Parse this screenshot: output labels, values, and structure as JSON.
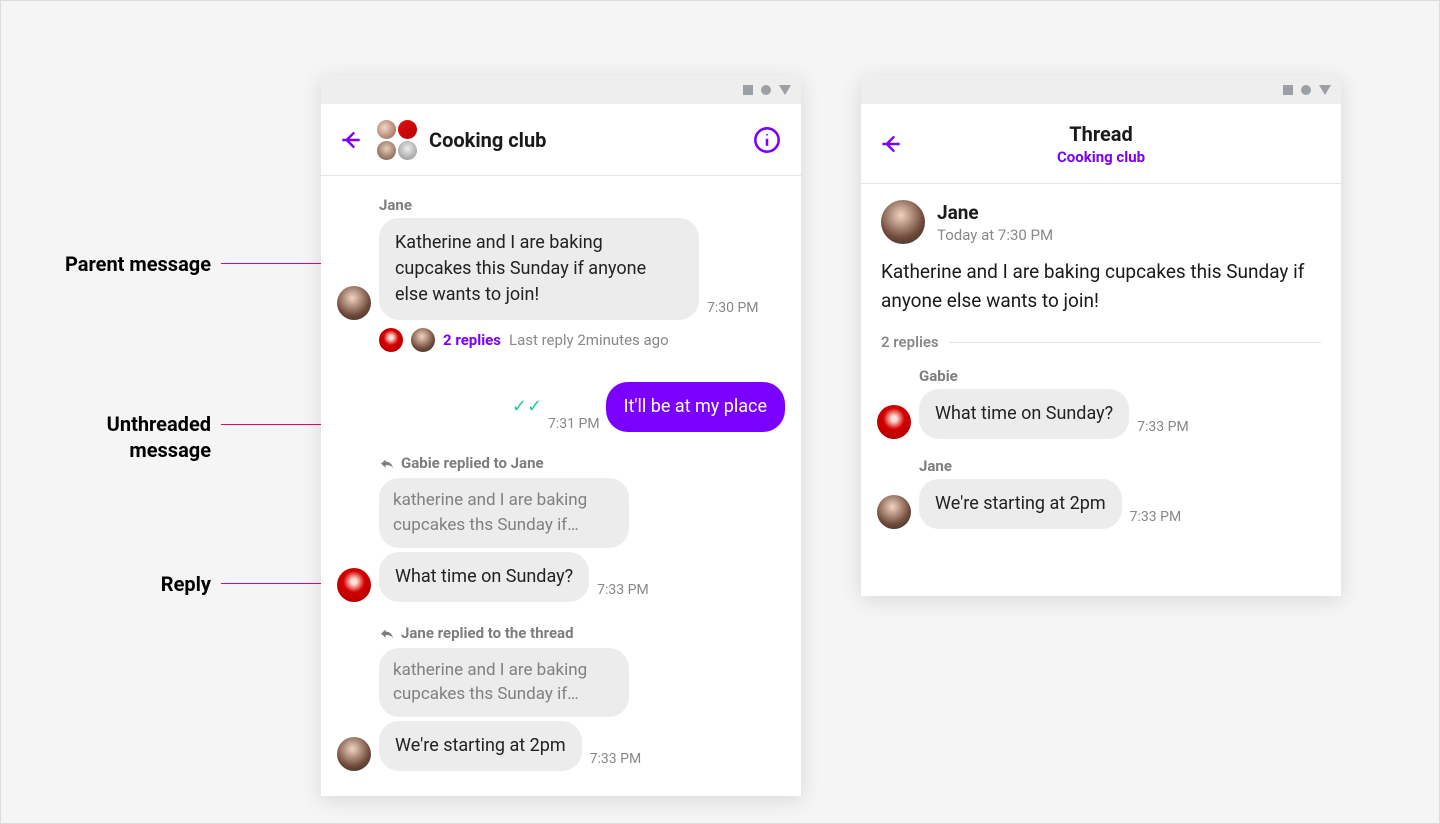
{
  "annotations": {
    "parent": "Parent message",
    "unthreaded_l1": "Unthreaded",
    "unthreaded_l2": "message",
    "reply": "Reply"
  },
  "left": {
    "chat_title": "Cooking club",
    "msg1_sender": "Jane",
    "msg1_text": "Katherine and I are baking cupcakes this Sunday if anyone else wants to join!",
    "msg1_ts": "7:30 PM",
    "thread_count": "2 replies",
    "thread_last": "Last reply 2minutes ago",
    "mine_ts": "7:31 PM",
    "mine_text": "It'll be at my place",
    "reply1_header": "Gabie replied to Jane",
    "quote_text": "katherine and I are baking cupcakes ths Sunday if…",
    "reply1_text": "What time on Sunday?",
    "reply1_ts": "7:33 PM",
    "reply2_header": "Jane replied to the thread",
    "reply2_text": "We're starting at 2pm",
    "reply2_ts": "7:33 PM"
  },
  "right": {
    "title": "Thread",
    "subtitle": "Cooking club",
    "parent_name": "Jane",
    "parent_time": "Today at 7:30 PM",
    "parent_text": "Katherine and I are baking cupcakes this Sunday if anyone else wants to join!",
    "replies_label": "2 replies",
    "r1_sender": "Gabie",
    "r1_text": "What time on Sunday?",
    "r1_ts": "7:33 PM",
    "r2_sender": "Jane",
    "r2_text": "We're starting at 2pm",
    "r2_ts": "7:33 PM"
  }
}
